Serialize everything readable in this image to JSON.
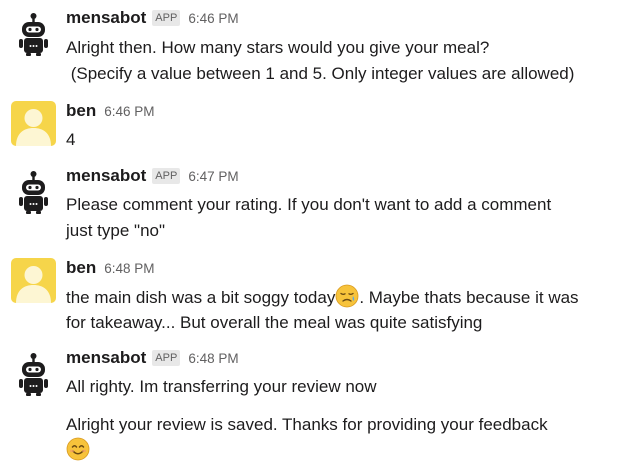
{
  "messages": [
    {
      "author": "mensabot",
      "badge": "APP",
      "time": "6:46 PM",
      "lines": [
        "Alright then. How many stars would you give your meal?",
        " (Specify a value between 1 and 5. Only integer values are allowed)"
      ]
    },
    {
      "author": "ben",
      "time": "6:46 PM",
      "lines": [
        "4"
      ]
    },
    {
      "author": "mensabot",
      "badge": "APP",
      "time": "6:47 PM",
      "lines": [
        "Please comment your rating. If you don't want to add a comment",
        "just type \"no\""
      ]
    },
    {
      "author": "ben",
      "time": "6:48 PM",
      "line1_before_emoji": "the main dish was a bit soggy today",
      "line1_emoji": "sad-relieved-face-emoji",
      "line1_after_emoji": ". Maybe thats because it was",
      "line2": "for takeaway... But overall the meal was quite satisfying"
    },
    {
      "author": "mensabot",
      "badge": "APP",
      "time": "6:48 PM",
      "lines": [
        "All righty. Im transferring your review now",
        "Alright your review is saved. Thanks for providing your feedback"
      ],
      "trailing_emoji": "smiling-face-with-smiling-eyes-emoji"
    }
  ],
  "colors": {
    "text": "#1d1c1d",
    "muted": "#616061",
    "badge_bg": "#e8e8e8",
    "user_avatar_bg": "#f6d54a",
    "user_avatar_fg": "#fdf6d3",
    "bot_avatar": "#1d1c1d"
  }
}
